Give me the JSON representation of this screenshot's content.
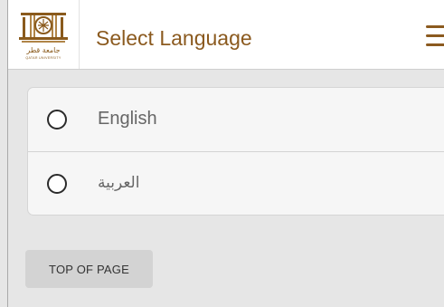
{
  "header": {
    "title": "Select Language",
    "logo": {
      "arabic_name": "جامعة قطر",
      "english_name": "QATAR UNIVERSITY",
      "icon": "qatar-university-emblem"
    },
    "menu_icon": "hamburger-menu-icon"
  },
  "languages": [
    {
      "label": "English",
      "selected": false
    },
    {
      "label": "العربية",
      "selected": false
    }
  ],
  "footer": {
    "top_button_label": "TOP OF PAGE"
  },
  "colors": {
    "brand": "#8b5a1f",
    "background": "#e6e6e6",
    "card": "#f6f6f6",
    "button": "#d3d3d3"
  }
}
